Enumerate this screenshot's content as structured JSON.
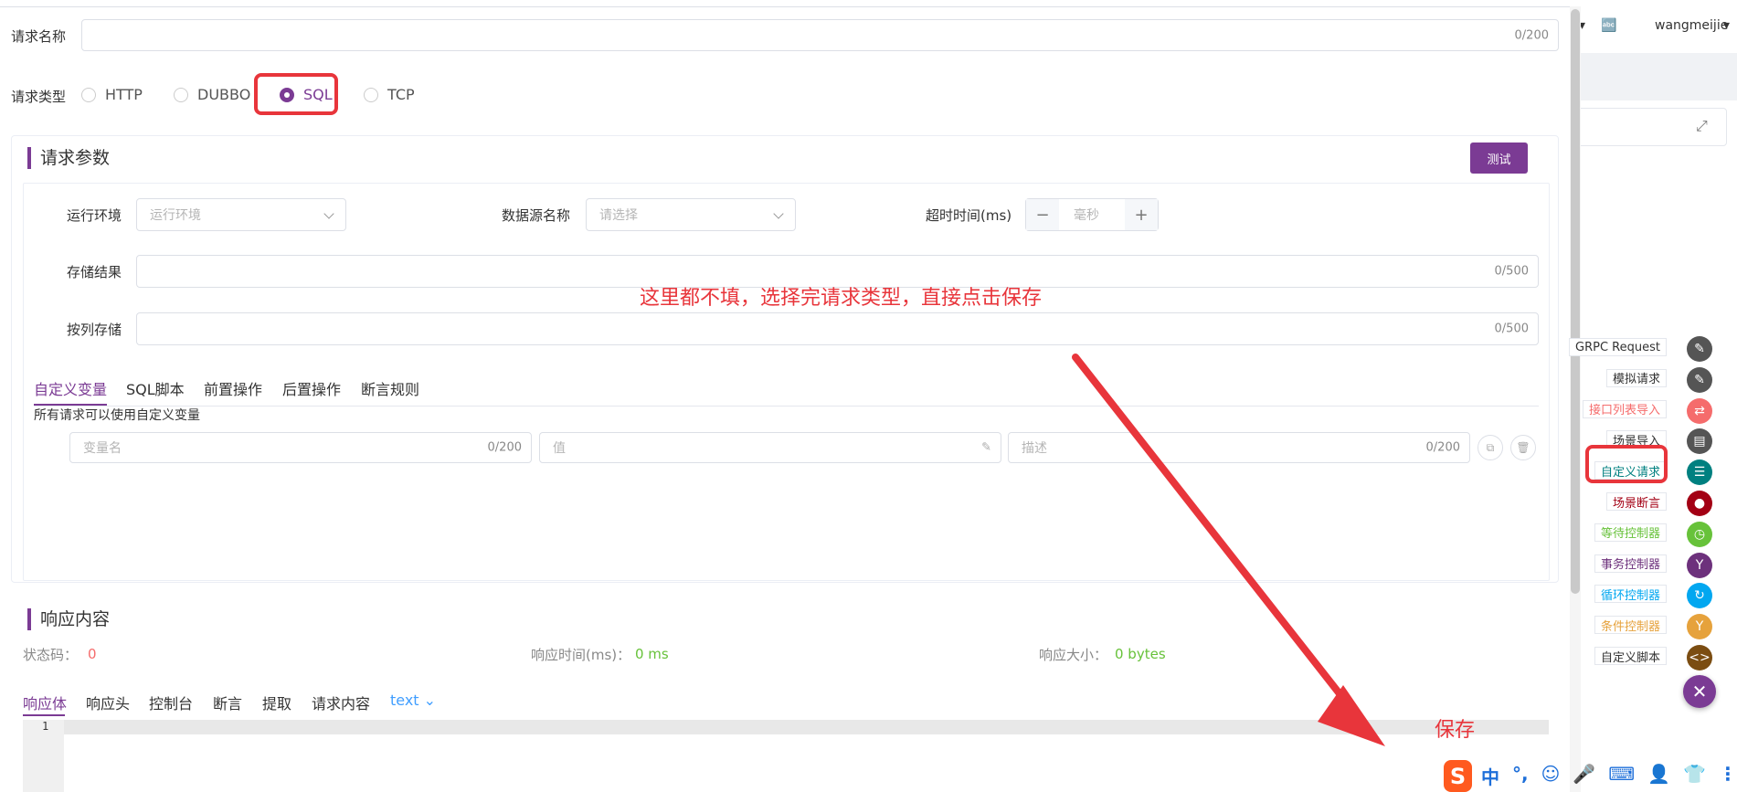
{
  "topbar": {
    "user": "wangmeijie",
    "lang_icon": "translate-icon"
  },
  "form": {
    "name_label": "请求名称",
    "name_counter": "0/200",
    "type_label": "请求类型",
    "types": [
      "HTTP",
      "DUBBO",
      "SQL",
      "TCP"
    ],
    "selected_type": "SQL"
  },
  "params": {
    "title": "请求参数",
    "test_button": "测试",
    "env_label": "运行环境",
    "env_placeholder": "运行环境",
    "datasource_label": "数据源名称",
    "datasource_placeholder": "请选择",
    "timeout_label": "超时时间(ms)",
    "timeout_placeholder": "毫秒",
    "minus": "−",
    "plus": "+",
    "store_label": "存储结果",
    "store_counter": "0/500",
    "col_store_label": "按列存储",
    "col_store_counter": "0/500",
    "tabs": [
      "自定义变量",
      "SQL脚本",
      "前置操作",
      "后置操作",
      "断言规则"
    ],
    "tab_hint": "所有请求可以使用自定义变量",
    "var_name_placeholder": "变量名",
    "var_name_counter": "0/200",
    "var_value_placeholder": "值",
    "var_desc_placeholder": "描述",
    "var_desc_counter": "0/200"
  },
  "annotation": {
    "note": "这里都不填，选择完请求类型，直接点击保存",
    "save": "保存"
  },
  "response": {
    "title": "响应内容",
    "status_label": "状态码：",
    "status_value": "0",
    "time_label": "响应时间(ms)：",
    "time_value": "0 ms",
    "size_label": "响应大小：",
    "size_value": "0 bytes",
    "tabs": [
      "响应体",
      "响应头",
      "控制台",
      "断言",
      "提取",
      "请求内容"
    ],
    "format": "text",
    "line_number": "1"
  },
  "toolbar": [
    {
      "label": "GRPC Request",
      "color": "#555555",
      "text_color": "#333333"
    },
    {
      "label": "模拟请求",
      "color": "#555555",
      "text_color": "#333333"
    },
    {
      "label": "接口列表导入",
      "color": "#f56c6c",
      "text_color": "#f56c6c"
    },
    {
      "label": "场景导入",
      "color": "#555555",
      "text_color": "#333333"
    },
    {
      "label": "自定义请求",
      "color": "#008080",
      "text_color": "#008080"
    },
    {
      "label": "场景断言",
      "color": "#a30014",
      "text_color": "#a30014"
    },
    {
      "label": "等待控制器",
      "color": "#67c23a",
      "text_color": "#67c23a"
    },
    {
      "label": "事务控制器",
      "color": "#6d317c",
      "text_color": "#6d317c"
    },
    {
      "label": "循环控制器",
      "color": "#02a7f0",
      "text_color": "#02a7f0"
    },
    {
      "label": "条件控制器",
      "color": "#e6a23c",
      "text_color": "#e6a23c"
    },
    {
      "label": "自定义脚本",
      "color": "#7b4d12",
      "text_color": "#333333"
    }
  ],
  "ime": [
    "中",
    "°,",
    "☺",
    "🎤",
    "⌨",
    "👤",
    "👕",
    "⋮"
  ],
  "colors": {
    "accent": "#7b3b94",
    "annotation": "#e8353b",
    "success": "#67c23a"
  }
}
